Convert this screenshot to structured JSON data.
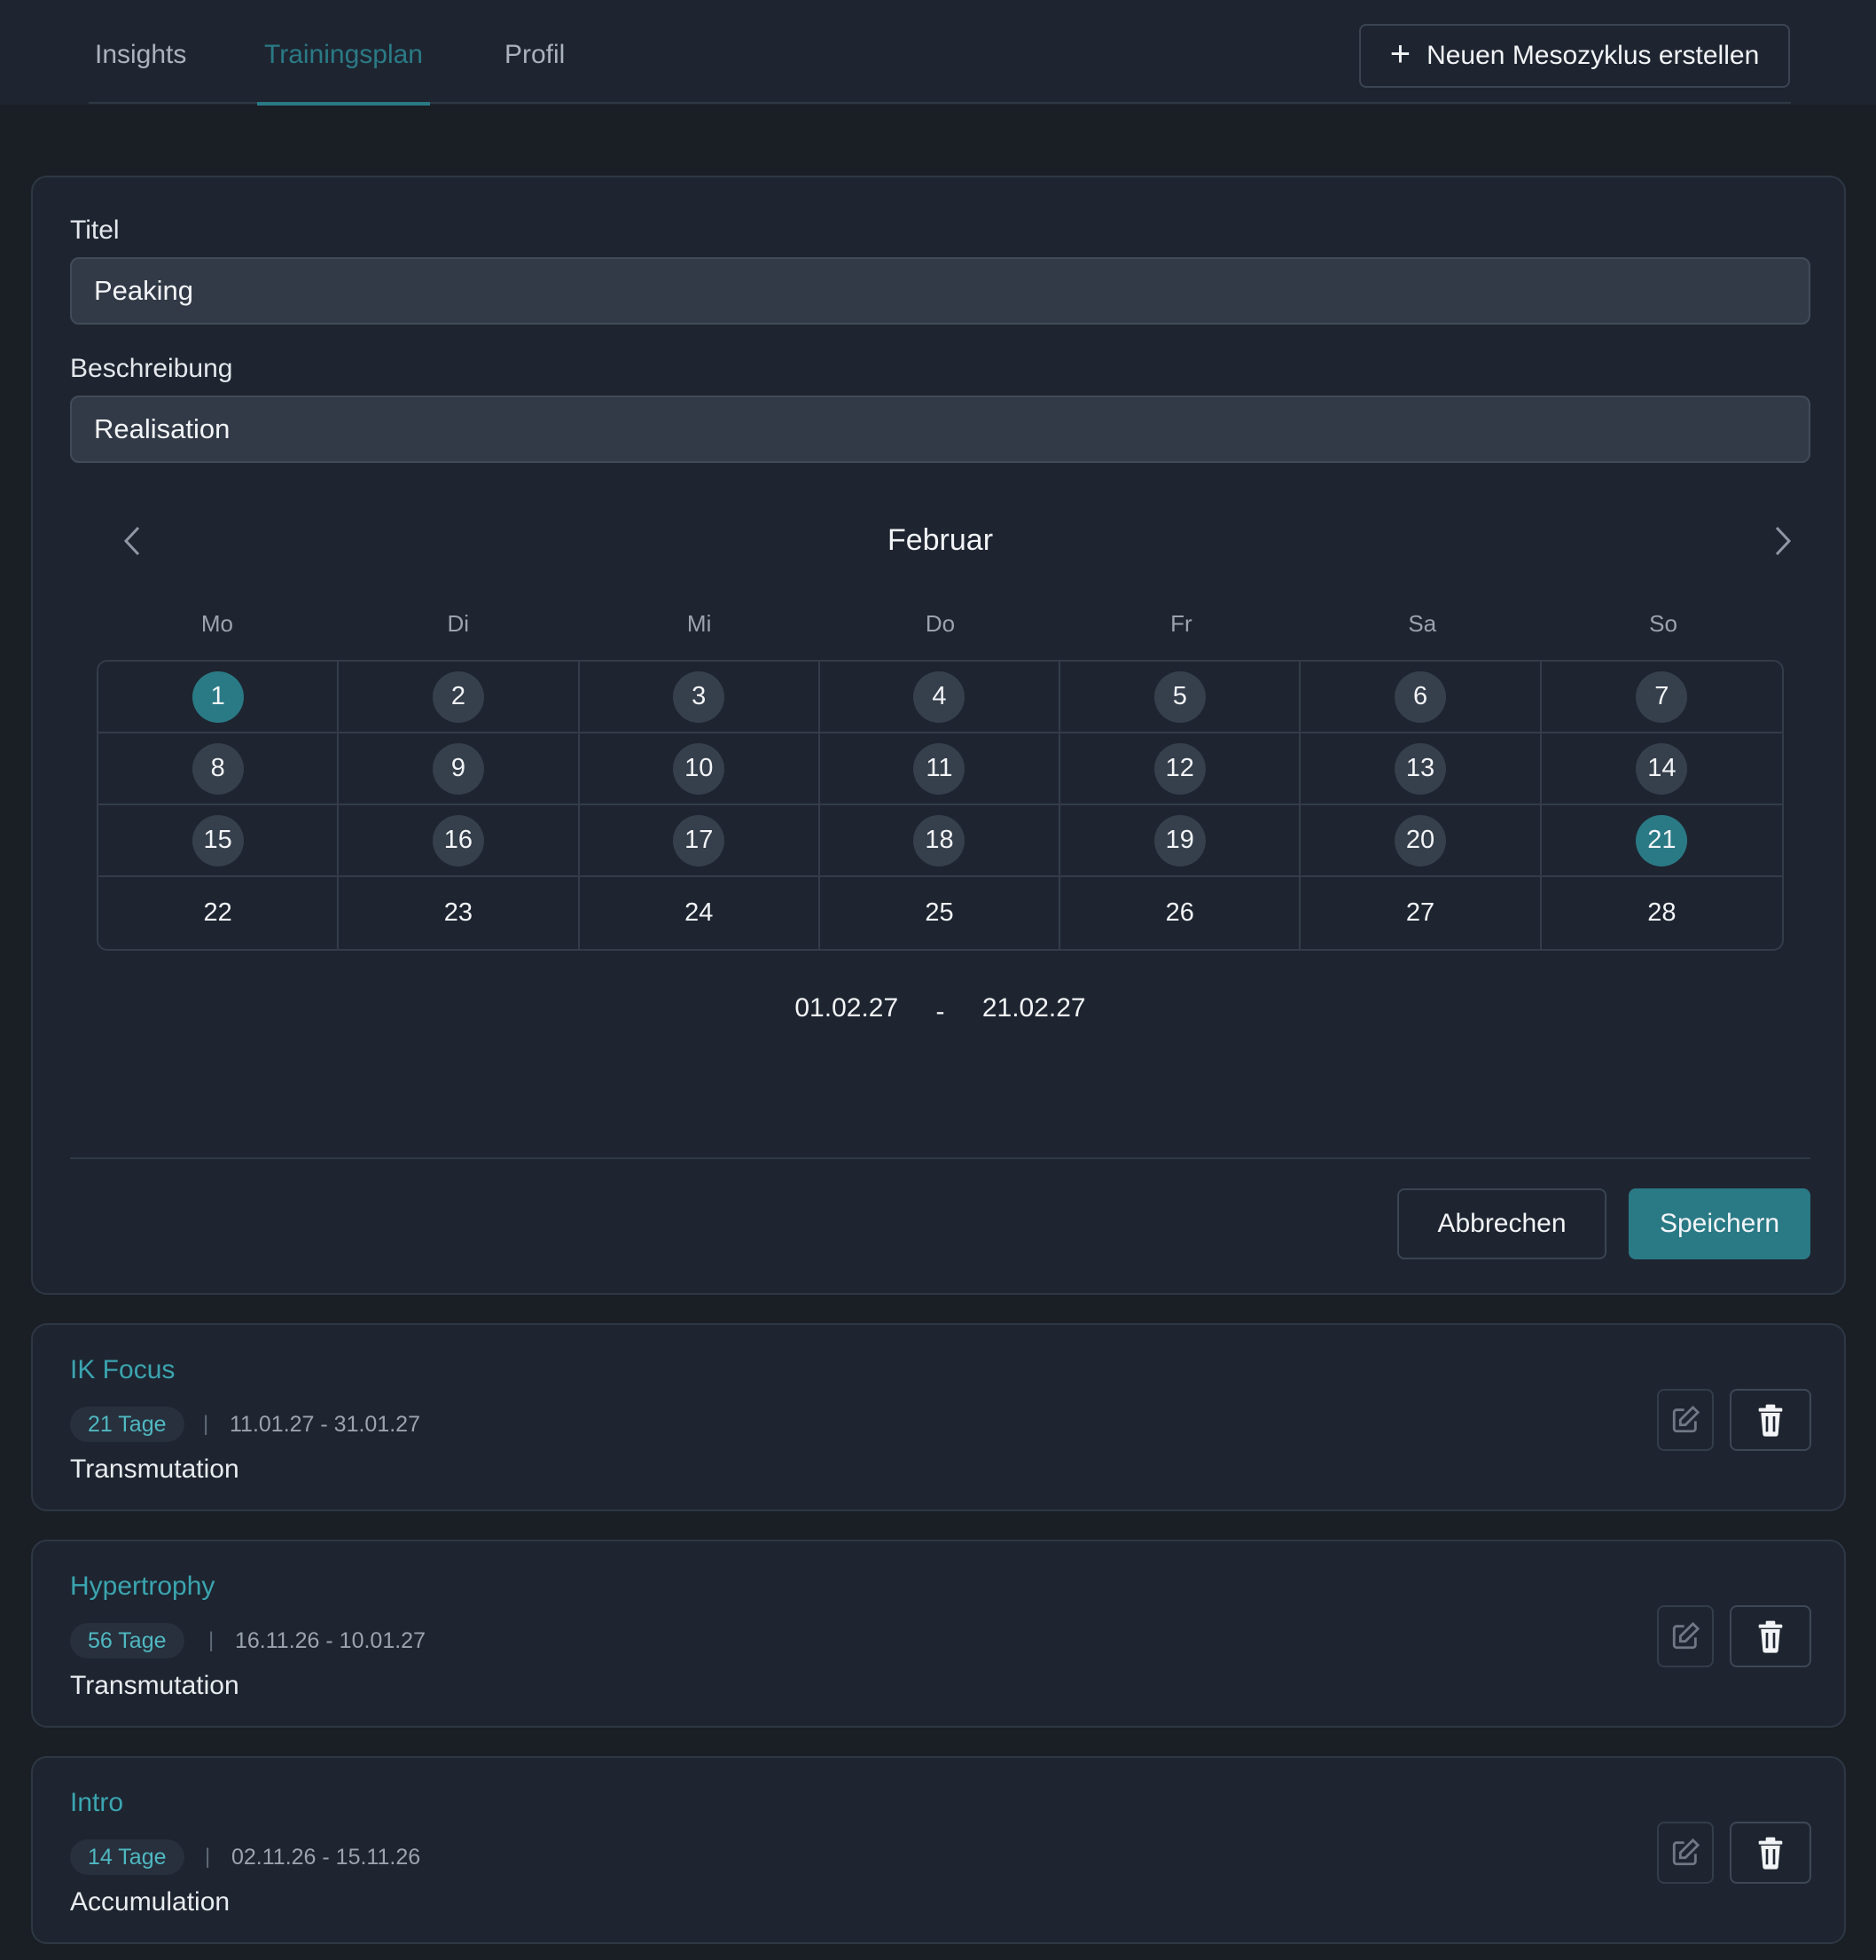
{
  "nav": {
    "tabs": [
      {
        "label": "Insights"
      },
      {
        "label": "Trainingsplan"
      },
      {
        "label": "Profil"
      }
    ],
    "new_button": "Neuen Mesozyklus erstellen"
  },
  "form": {
    "title_label": "Titel",
    "title_value": "Peaking",
    "description_label": "Beschreibung",
    "description_value": "Realisation",
    "calendar": {
      "month": "Februar",
      "weekdays": [
        "Mo",
        "Di",
        "Mi",
        "Do",
        "Fr",
        "Sa",
        "So"
      ],
      "days": [
        "1",
        "2",
        "3",
        "4",
        "5",
        "6",
        "7",
        "8",
        "9",
        "10",
        "11",
        "12",
        "13",
        "14",
        "15",
        "16",
        "17",
        "18",
        "19",
        "20",
        "21",
        "22",
        "23",
        "24",
        "25",
        "26",
        "27",
        "28"
      ],
      "range_start_day": 1,
      "range_end_day": 21
    },
    "range_start": "01.02.27",
    "range_separator": "-",
    "range_end": "21.02.27",
    "cancel_label": "Abbrechen",
    "save_label": "Speichern"
  },
  "cycles": [
    {
      "title": "IK Focus",
      "days": "21 Tage",
      "separator": "|",
      "dates": "11.01.27 - 31.01.27",
      "description": "Transmutation"
    },
    {
      "title": "Hypertrophy",
      "days": "56 Tage",
      "separator": "|",
      "dates": "16.11.26 - 10.01.27",
      "description": "Transmutation"
    },
    {
      "title": "Intro",
      "days": "14 Tage",
      "separator": "|",
      "dates": "02.11.26 - 15.11.26",
      "description": "Accumulation"
    }
  ],
  "icons": {
    "plus": "plus-icon",
    "prev": "chevron-left-icon",
    "next": "chevron-right-icon",
    "edit": "pencil-square-icon",
    "delete": "trash-icon"
  },
  "colors": {
    "accent": "#2a7a86",
    "accent_text": "#3aa5b0",
    "range_day": "#363f4c"
  }
}
